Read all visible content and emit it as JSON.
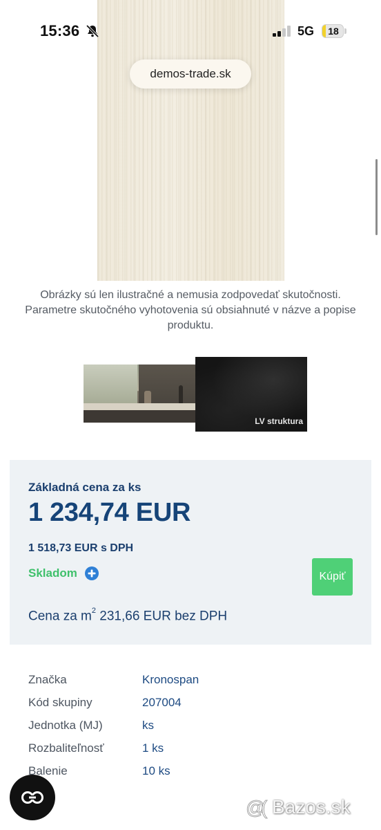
{
  "status_bar": {
    "time": "15:36",
    "network": "5G",
    "battery_level": "18",
    "battery_fraction": 0.18,
    "icons": [
      "bell-slash-icon",
      "signal-icon",
      "battery-icon"
    ]
  },
  "browser": {
    "url": "demos-trade.sk"
  },
  "product": {
    "disclaimer": "Obrázky sú len ilustračné a nemusia zodpovedať skutočnosti. Parametre skutočného vyhotovenia sú obsiahnuté v názve a popise produktu.",
    "thumbnail_label": "LV struktura"
  },
  "price": {
    "base_label": "Základná cena za ks",
    "main": "1 234,74 EUR",
    "with_vat": "1 518,73 EUR s DPH",
    "stock": "Skladom",
    "buy_label": "Kúpiť",
    "unit_prefix": "Cena za m",
    "unit_exp": "2",
    "unit_rest": " 231,66 EUR bez DPH"
  },
  "specs": [
    {
      "key": "Značka",
      "value": "Kronospan"
    },
    {
      "key": "Kód skupiny",
      "value": "207004"
    },
    {
      "key": "Jednotka (MJ)",
      "value": "ks"
    },
    {
      "key": "Rozbaliteľnosť",
      "value": "1 ks"
    },
    {
      "key": "Balenie",
      "value": "10 ks"
    }
  ],
  "watermark": {
    "text": "Bazos.sk"
  },
  "colors": {
    "price_blue": "#164478",
    "stock_green": "#3fc06b",
    "buy_green": "#4fd077",
    "price_box_bg": "#eef2f5"
  }
}
